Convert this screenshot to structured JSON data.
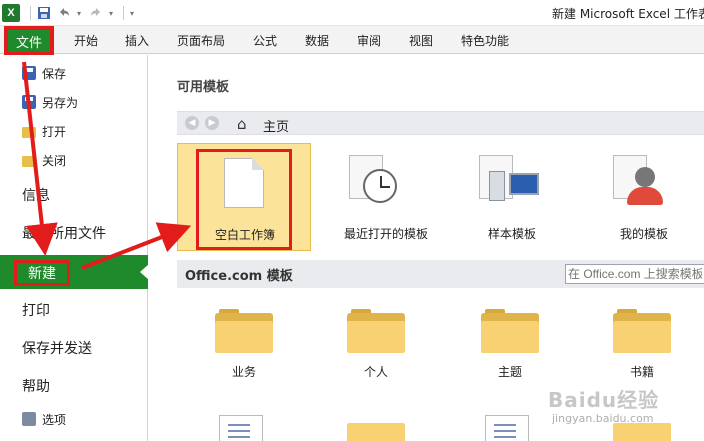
{
  "window": {
    "title": "新建 Microsoft Excel 工作表"
  },
  "qat": {
    "app_icon": "X",
    "items": [
      "save-icon",
      "undo-icon",
      "redo-icon"
    ]
  },
  "ribbon": {
    "file_tab": "文件",
    "tabs": [
      "开始",
      "插入",
      "页面布局",
      "公式",
      "数据",
      "审阅",
      "视图",
      "特色功能"
    ]
  },
  "backstage_nav": {
    "save": "保存",
    "save_as": "另存为",
    "open": "打开",
    "close": "关闭",
    "info": "信息",
    "recent": "最近所用文件",
    "new": "新建",
    "print": "打印",
    "save_send": "保存并发送",
    "help": "帮助",
    "options": "选项"
  },
  "main": {
    "section_title": "可用模板",
    "home_label": "主页",
    "templates": [
      {
        "label": "空白工作簿",
        "selected": true
      },
      {
        "label": "最近打开的模板",
        "selected": false
      },
      {
        "label": "样本模板",
        "selected": false
      },
      {
        "label": "我的模板",
        "selected": false
      }
    ],
    "office_title": "Office.com 模板",
    "office_search_placeholder": "在 Office.com 上搜索模板",
    "folders": [
      "业务",
      "个人",
      "主题",
      "书籍"
    ]
  },
  "watermark": {
    "logo": "Baidu经验",
    "url": "jingyan.baidu.com"
  },
  "colors": {
    "file_green": "#1f8a2b",
    "highlight_red": "#e21b1b",
    "selected_tile": "#fbe39a"
  }
}
